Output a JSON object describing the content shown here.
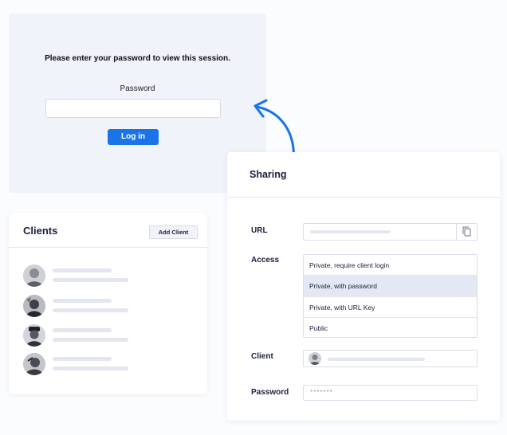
{
  "login": {
    "prompt": "Please enter your password to view this session.",
    "password_label": "Password",
    "password_value": "",
    "login_button": "Log in",
    "accent_color": "#1a74e8"
  },
  "clients": {
    "title": "Clients",
    "add_button": "Add Client",
    "rows": [
      {
        "avatar": "client-avatar-photo"
      },
      {
        "avatar": "client-avatar-photo"
      },
      {
        "avatar": "client-avatar-photo"
      },
      {
        "avatar": "client-avatar-photo"
      }
    ]
  },
  "sharing": {
    "title": "Sharing",
    "url_label": "URL",
    "copy_icon": "copy-icon",
    "access_label": "Access",
    "access_options": [
      {
        "label": "Private, require client login",
        "selected": false
      },
      {
        "label": "Private, with password",
        "selected": true
      },
      {
        "label": "Private, with URL Key",
        "selected": false
      },
      {
        "label": "Public",
        "selected": false
      }
    ],
    "client_label": "Client",
    "password_label": "Password",
    "password_value": "*******"
  }
}
